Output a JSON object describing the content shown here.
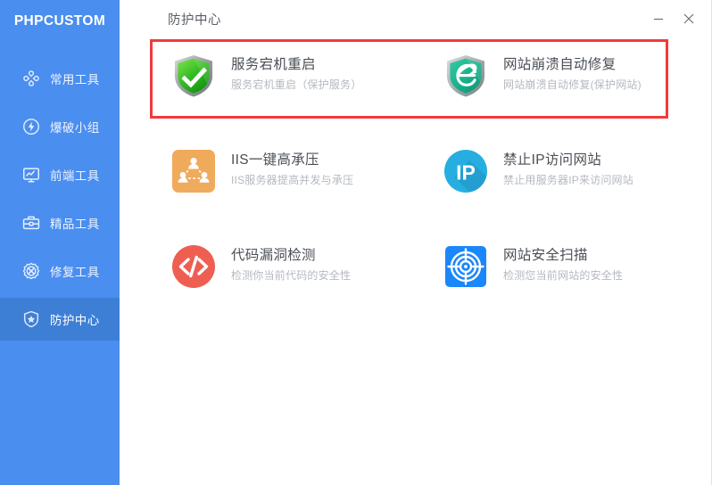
{
  "app": {
    "brand": "PHPCUSTOM",
    "accent_blue": "#4a8ef0",
    "accent_blue_active": "#3e7fd6",
    "highlight_red": "#f23a3a"
  },
  "sidebar": {
    "items": [
      {
        "label": "常用工具",
        "icon": "puzzle-tools-icon",
        "active": false
      },
      {
        "label": "爆破小组",
        "icon": "lightning-bolt-icon",
        "active": false
      },
      {
        "label": "前端工具",
        "icon": "monitor-chart-icon",
        "active": false
      },
      {
        "label": "精品工具",
        "icon": "toolbox-icon",
        "active": false
      },
      {
        "label": "修复工具",
        "icon": "gear-repair-icon",
        "active": false
      },
      {
        "label": "防护中心",
        "icon": "shield-star-icon",
        "active": true
      }
    ]
  },
  "titlebar": {
    "title": "防护中心",
    "minimize_label": "minimize",
    "close_label": "close"
  },
  "main": {
    "tiles": [
      {
        "title": "服务宕机重启",
        "subtitle": "服务宕机重启（保护服务）",
        "icon": "green-shield-check-icon",
        "highlighted": true
      },
      {
        "title": "网站崩溃自动修复",
        "subtitle": "网站崩溃自动修复(保护网站)",
        "icon": "teal-shield-ie-icon",
        "highlighted": true
      },
      {
        "title": "IIS一键高承压",
        "subtitle": "IIS服务器提高并发与承压",
        "icon": "orange-users-network-icon",
        "highlighted": false
      },
      {
        "title": "禁止IP访问网站",
        "subtitle": "禁止用服务器IP来访问网站",
        "icon": "blue-ip-circle-icon",
        "highlighted": false
      },
      {
        "title": "代码漏洞检测",
        "subtitle": "检测你当前代码的安全性",
        "icon": "red-code-circle-icon",
        "highlighted": false
      },
      {
        "title": "网站安全扫描",
        "subtitle": "检测您当前网站的安全性",
        "icon": "blue-radar-target-icon",
        "highlighted": false
      }
    ]
  }
}
